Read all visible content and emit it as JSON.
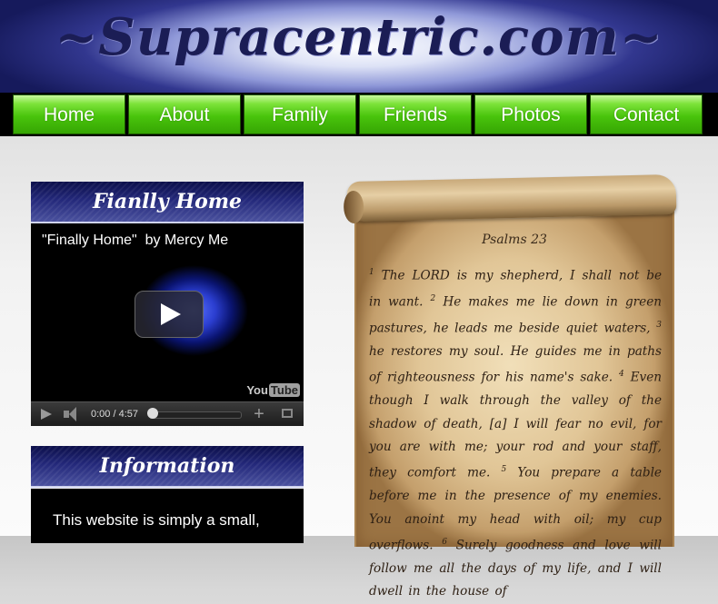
{
  "header": {
    "site_title": "~Supracentric.com~"
  },
  "nav": {
    "items": [
      {
        "label": "Home"
      },
      {
        "label": "About"
      },
      {
        "label": "Family"
      },
      {
        "label": "Friends"
      },
      {
        "label": "Photos"
      },
      {
        "label": "Contact"
      }
    ]
  },
  "sidebar": {
    "video_panel": {
      "heading": "Fianlly Home",
      "video_title": "\"Finally Home\"  by Mercy Me",
      "time": "0:00 / 4:57",
      "progress": 0,
      "logo_you": "You",
      "logo_tube": "Tube"
    },
    "info_panel": {
      "heading": "Information",
      "body": "This website is simply a small,"
    }
  },
  "scroll": {
    "heading": "Psalms 23",
    "verses": [
      {
        "num": "1",
        "text": "The LORD is my shepherd, I shall not be in want. "
      },
      {
        "num": "2",
        "text": "He makes me lie down in green pastures, he leads me beside quiet waters, "
      },
      {
        "num": "3",
        "text": "he restores my soul. He guides me in paths of righteousness for his name's sake. "
      },
      {
        "num": "4",
        "text": "Even though I walk through the valley of the shadow of death, [a] I will fear no evil, for you are with me; your rod and your staff, they comfort me. "
      },
      {
        "num": "5",
        "text": "You prepare a table before me in the presence of my enemies. You anoint my head with oil; my cup overflows. "
      },
      {
        "num": "6",
        "text": "Surely goodness and love will follow me all the days of my life, and I will dwell in the house of"
      }
    ]
  }
}
